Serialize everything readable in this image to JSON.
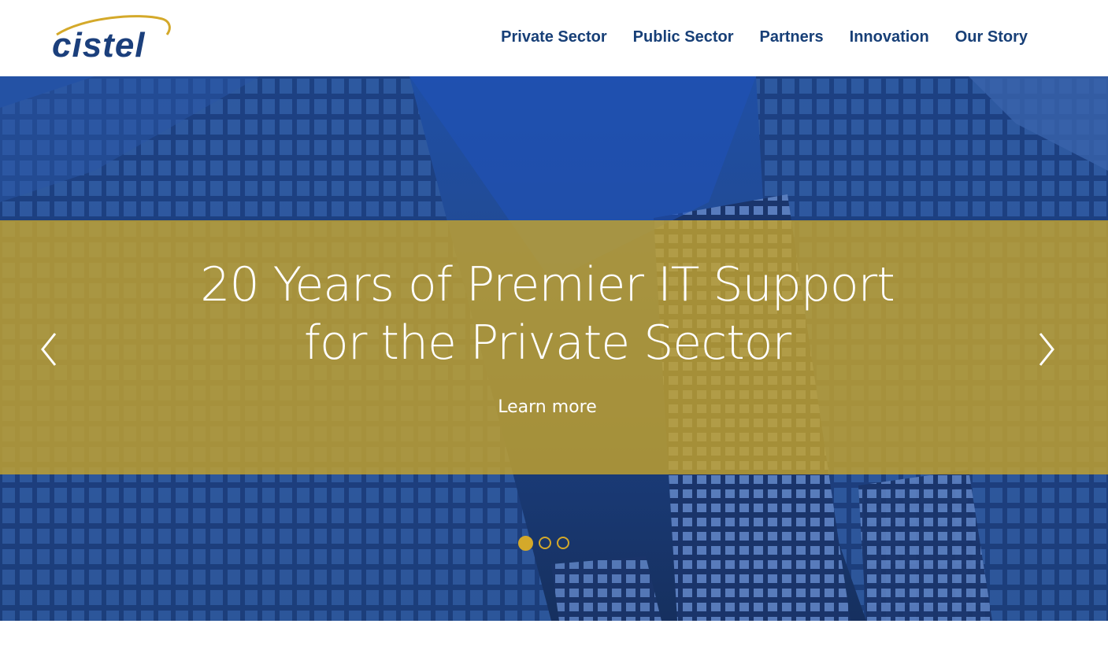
{
  "brand": {
    "logo_text": "cistel",
    "colors": {
      "navy": "#1b3f7c",
      "gold": "#d4a92a",
      "band": "#c4a32d"
    }
  },
  "nav": {
    "items": [
      {
        "label": "Private Sector"
      },
      {
        "label": "Public Sector"
      },
      {
        "label": "Partners"
      },
      {
        "label": "Innovation"
      },
      {
        "label": "Our Story"
      }
    ]
  },
  "hero": {
    "headline_line1": "20 Years of Premier IT Support",
    "headline_line2": "for the Private Sector",
    "cta_label": "Learn more",
    "prev_icon": "chevron-left-icon",
    "next_icon": "chevron-right-icon",
    "slides_total": 3,
    "active_slide": 1
  }
}
